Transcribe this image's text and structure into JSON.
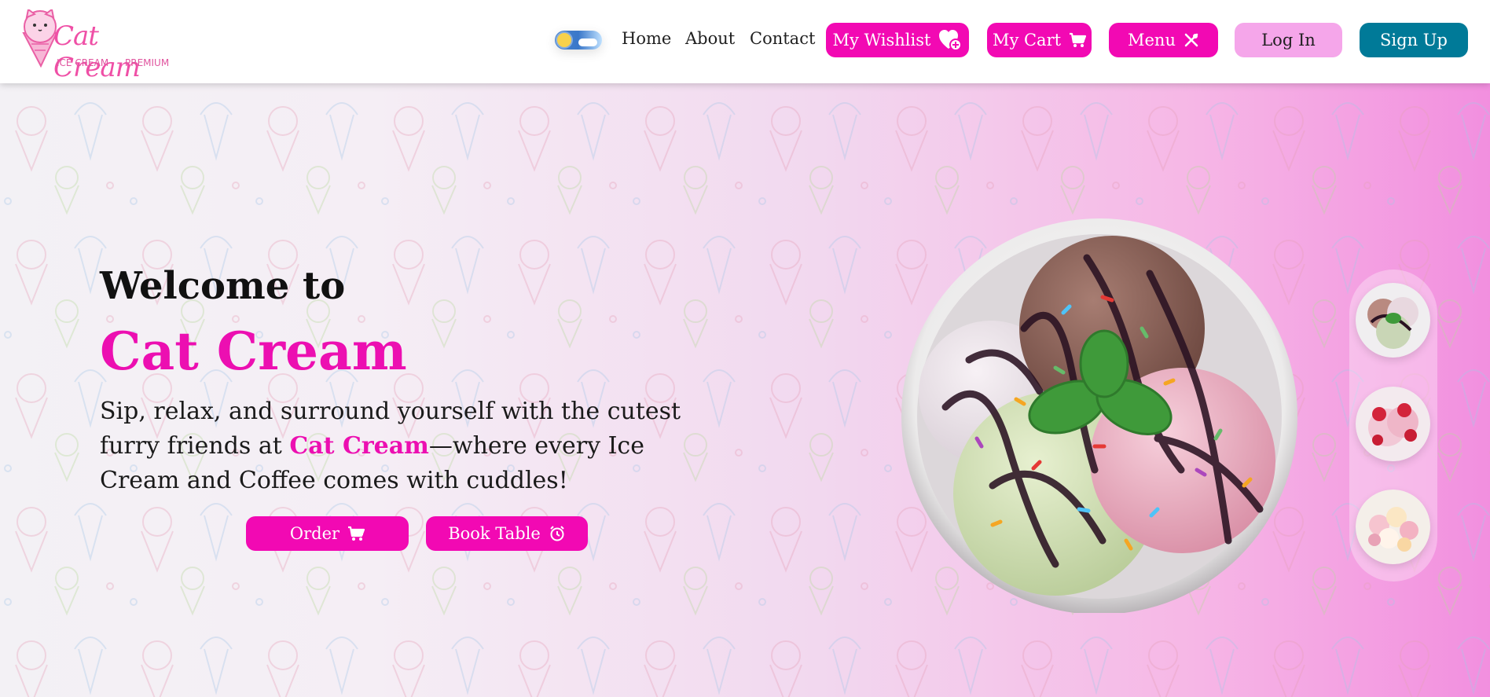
{
  "header": {
    "logo": {
      "title": "Cat Cream",
      "sub_left": "ICE CREAM",
      "sub_right": "PREMIUM"
    },
    "theme_toggle": {
      "state": "light",
      "icon_left": "sun-icon",
      "icon_right": "cloud-icon"
    },
    "nav": [
      {
        "label": "Home"
      },
      {
        "label": "About"
      },
      {
        "label": "Contact"
      }
    ],
    "wishlist": {
      "label": "My Wishlist",
      "icon": "heart-plus-icon"
    },
    "cart": {
      "label": "My Cart",
      "icon": "cart-icon"
    },
    "menu": {
      "label": "Menu",
      "icon": "utensils-icon"
    },
    "login": {
      "label": "Log In"
    },
    "signup": {
      "label": "Sign Up"
    }
  },
  "hero": {
    "welcome": "Welcome to",
    "brand": "Cat Cream",
    "tagline_before": "Sip, relax, and surround yourself with the cutest furry friends at ",
    "tagline_brand": "Cat Cream",
    "tagline_after": "—where every Ice Cream and Coffee comes with cuddles!",
    "order": {
      "label": "Order",
      "icon": "cart-icon"
    },
    "book": {
      "label": "Book Table",
      "icon": "alarm-clock-icon"
    },
    "featured_image": "ice-cream-bowl-image",
    "thumbnails": [
      "ice-cream-bowl-mint-thumbnail",
      "strawberry-ice-cream-thumbnail",
      "assorted-scoops-thumbnail"
    ]
  },
  "colors": {
    "primary": "#f209b3",
    "login_bg": "#f5a6ea",
    "signup_bg": "#007a98",
    "brand_text": "#ec0fb1"
  }
}
